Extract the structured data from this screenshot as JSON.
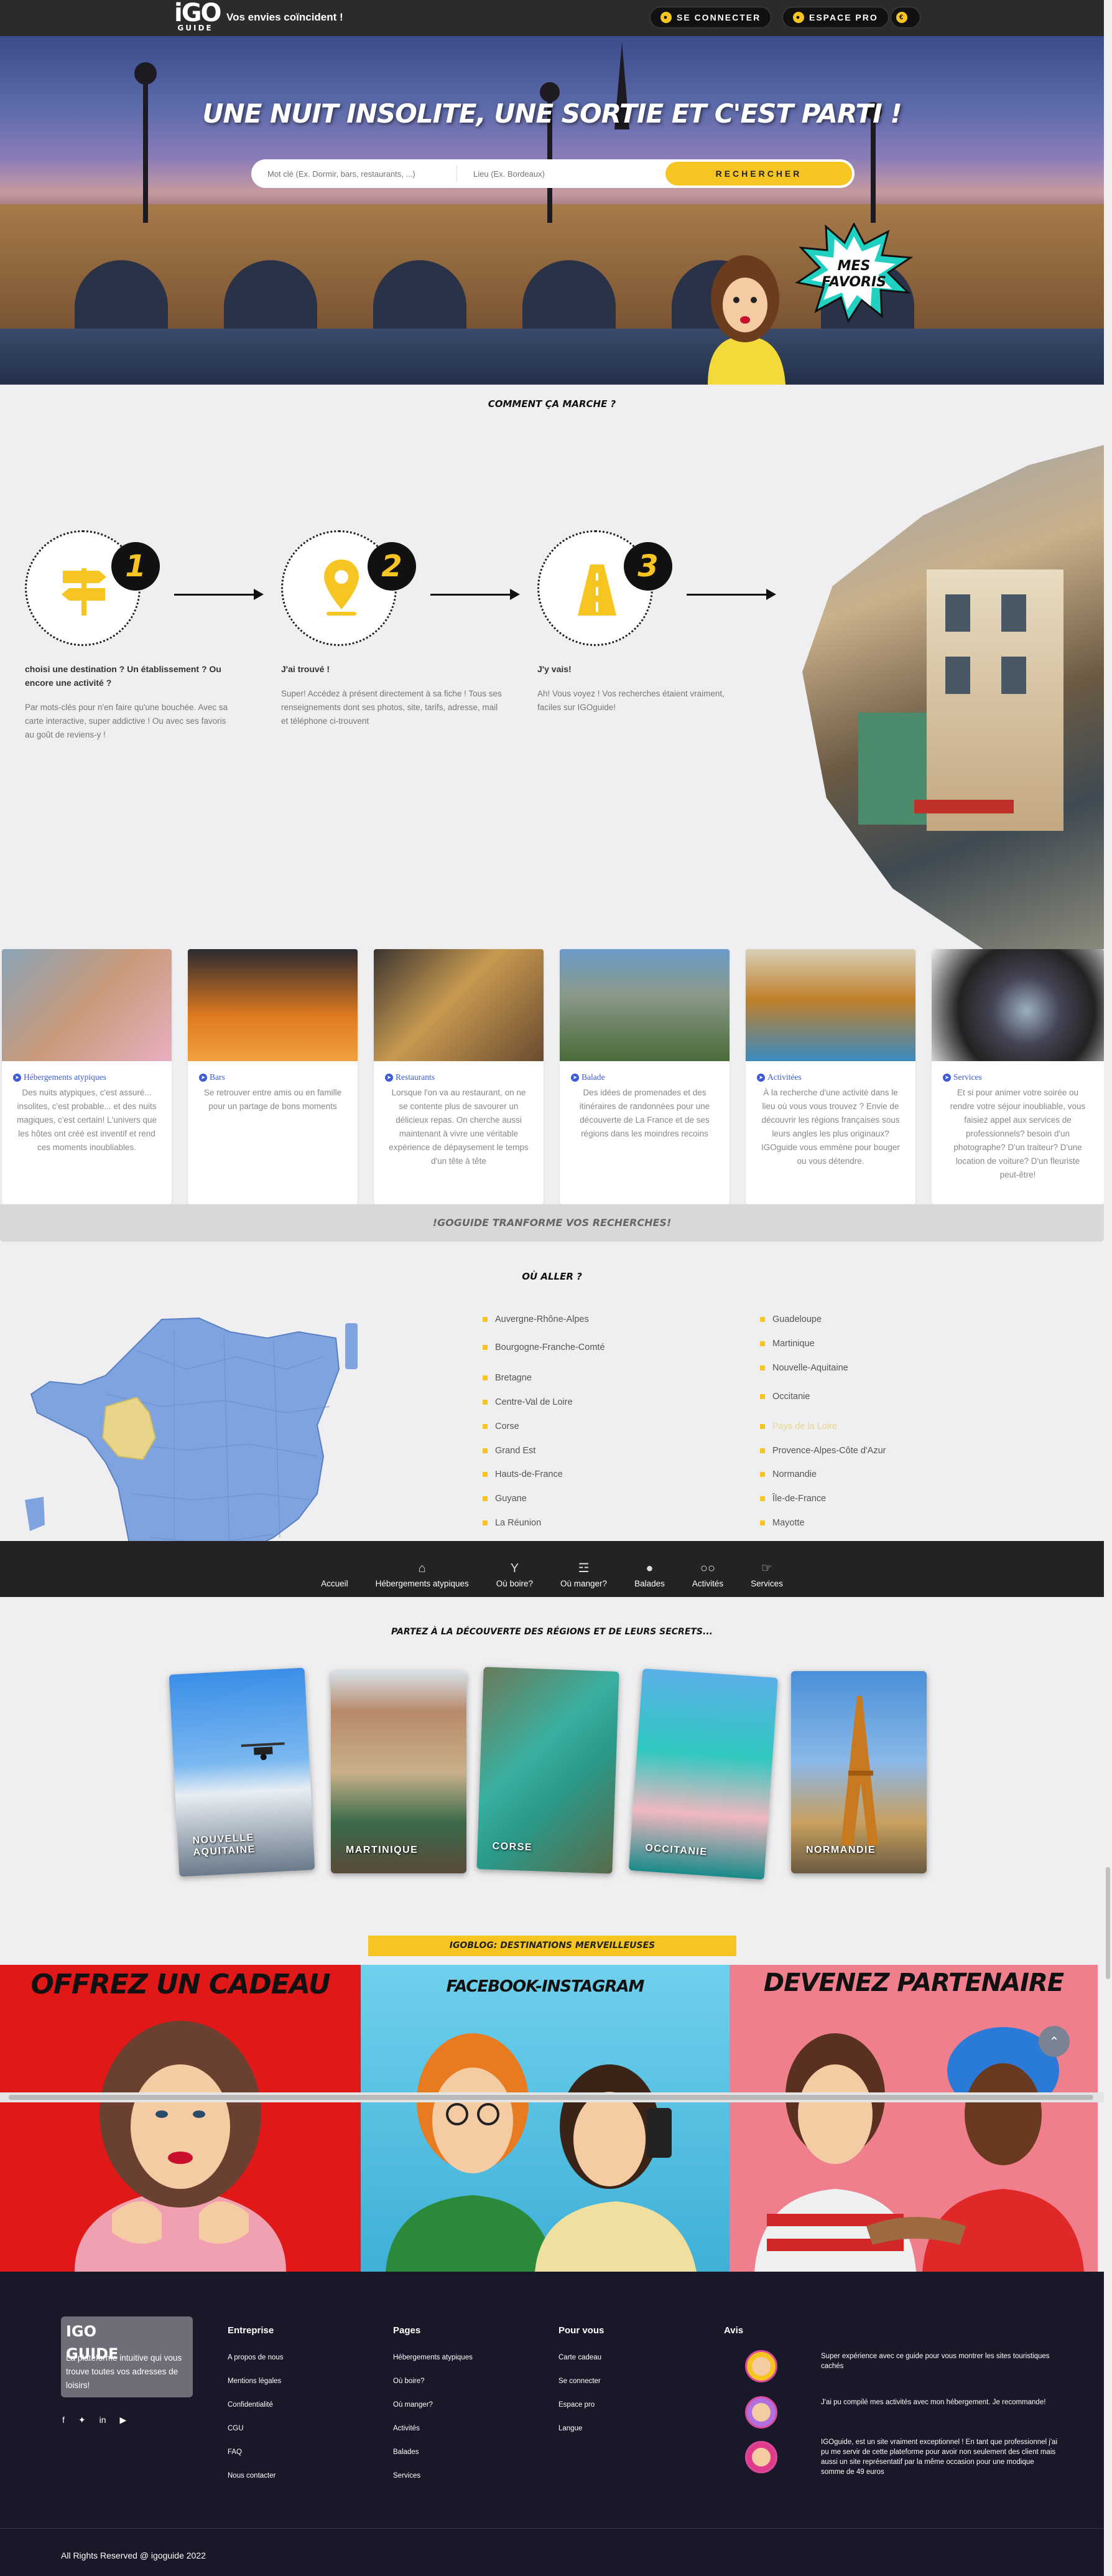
{
  "header": {
    "logo_top": "iGO",
    "logo_bottom": "GUIDE",
    "tagline": "Vos envies coïncident !",
    "login_label": "SE CONNECTER",
    "pro_label": "ESPACE PRO",
    "lang_label": "€"
  },
  "hero": {
    "title": "UNE NUIT INSOLITE, UNE SORTIE ET C'EST PARTI !",
    "search_placeholder": "Mot clé (Ex. Dormir, bars, restaurants, ...)",
    "place_placeholder": "Lieu (Ex. Bordeaux)",
    "search_button": "RECHERCHER",
    "favorites_badge": "MES FAVORIS"
  },
  "how": {
    "title": "COMMENT ÇA MARCHE ?",
    "steps": [
      {
        "num": "1",
        "heading": "choisi une destination ? Un établissement ? Ou encore une activité ?",
        "text": "Par mots-clés pour n'en faire qu'une bouchée. Avec sa carte interactive, super addictive ! Ou avec ses favoris au goût de reviens-y !"
      },
      {
        "num": "2",
        "heading": "J'ai trouvé !",
        "text": "Super! Accédez à présent directement à sa fiche ! Tous ses renseignements dont ses photos, site, tarifs, adresse, mail et téléphone ci-trouvent"
      },
      {
        "num": "3",
        "heading": "J'y vais!",
        "text": "Ah! Vous voyez ! Vos recherches étaient vraiment, faciles sur IGOguide!"
      }
    ]
  },
  "categories": [
    {
      "title": "Hébergements atypiques",
      "text": "Des nuits atypiques, c'est assuré... insolites, c'est probable... et des nuits magiques, c'est certain! L'univers que les hôtes ont créé est inventif et rend ces moments inoubliables."
    },
    {
      "title": "Bars",
      "text": "Se retrouver entre amis ou en famille pour un partage de bons moments"
    },
    {
      "title": "Restaurants",
      "text": "Lorsque l'on va au restaurant, on ne se contente plus de savourer un délicieux repas. On cherche aussi maintenant à vivre une véritable expérience de dépaysement le temps d'un tête à tête"
    },
    {
      "title": "Balade",
      "text": "Des idées de promenades et des itinéraires de randonnées pour une découverte de La France et de ses régions dans les moindres recoins"
    },
    {
      "title": "Activitées",
      "text": "À la recherche d'une activité dans le lieu où vous vous trouvez ? Envie de découvrir les régions françaises sous leurs angles les plus originaux? IGOguide vous emmène pour bouger ou vous détendre."
    },
    {
      "title": "Services",
      "text": "Et si pour animer votre soirée ou rendre votre séjour inoubliable, vous faisiez appel aux services de professionnels? besoin d'un photographe? D'un traiteur? D'une location de voiture? D'un fleuriste peut-être!"
    }
  ],
  "transform_banner": "!GOGUIDE TRANFORME VOS RECHERCHES!",
  "where": {
    "title": "OÙ ALLER ?",
    "col1": [
      "Auvergne-Rhône-Alpes",
      "Bourgogne-Franche-Comté",
      "Bretagne",
      "Centre-Val de Loire",
      "Corse",
      "Grand Est",
      "Hauts-de-France",
      "Guyane",
      "La Réunion"
    ],
    "col2": [
      "Guadeloupe",
      "Martinique",
      "Nouvelle-Aquitaine",
      "Occitanie",
      "Pays de la Loire",
      "Provence-Alpes-Côte d'Azur",
      "Normandie",
      "Île-de-France",
      "Mayotte"
    ],
    "highlight_color": "#e8d58a"
  },
  "nav": [
    {
      "label": "Accueil",
      "icon": ""
    },
    {
      "label": "Hébergements atypiques",
      "icon": "hut-icon"
    },
    {
      "label": "Où boire?",
      "icon": "cocktail-icon"
    },
    {
      "label": "Où manger?",
      "icon": "food-icon"
    },
    {
      "label": "Balades",
      "icon": "footsteps-icon"
    },
    {
      "label": "Activités",
      "icon": "bike-icon"
    },
    {
      "label": "Services",
      "icon": "service-icon"
    }
  ],
  "discover": {
    "title": "PARTEZ À LA DÉCOUVERTE DES RÉGIONS ET DE LEURS SECRETS...",
    "regions": [
      "NOUVELLE AQUITAINE",
      "MARTINIQUE",
      "CORSE",
      "OCCITANIE",
      "NORMANDIE"
    ]
  },
  "blog_badge": "IGOBLOG: DESTINATIONS MERVEILLEUSES",
  "promos": [
    {
      "title": "OFFREZ UN CADEAU",
      "color": "#e01818"
    },
    {
      "title": "FACEBOOK-INSTAGRAM",
      "color": "#5fc2e0"
    },
    {
      "title": "DEVENEZ PARTENAIRE",
      "color": "#f07f8e"
    }
  ],
  "footer": {
    "logo_text": "IGO GUIDE",
    "about": "La plateforme intuitive qui vous trouve toutes vos adresses de loisirs!",
    "columns": [
      {
        "title": "Entreprise",
        "links": [
          "A propos de nous",
          "Mentions légales",
          "Confidentialité",
          "CGU",
          "FAQ",
          "Nous contacter"
        ]
      },
      {
        "title": "Pages",
        "links": [
          "Hébergements atypiques",
          "Où boire?",
          "Où manger?",
          "Activités",
          "Balades",
          "Services"
        ]
      },
      {
        "title": "Pour vous",
        "links": [
          "Carte cadeau",
          "Se connecter",
          "Espace pro",
          "Langue"
        ]
      }
    ],
    "reviews_title": "Avis",
    "reviews": [
      "Super expérience avec ce guide pour vous montrer les sites touristiques cachés",
      "J'ai pu compilé mes activités avec mon hébergement. Je recommande!",
      "IGOguide, est un site vraiment exceptionnel ! En tant que professionnel j'ai pu me servir de cette plateforme pour avoir non seulement des client mais aussi un site représentatif par la même occasion pour une modique somme de 49 euros"
    ],
    "copyright": "All Rights Reserved @ igoguide 2022"
  }
}
